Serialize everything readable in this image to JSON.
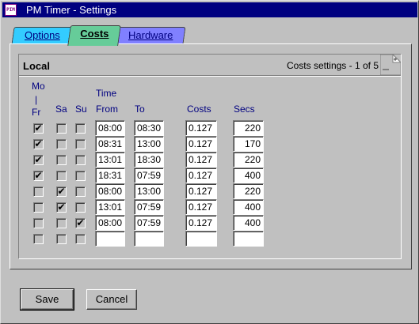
{
  "window": {
    "title": "PM Timer - Settings",
    "icon_name": "pm-app-icon",
    "icon_text": "PIM"
  },
  "tabs": [
    {
      "label": "Options",
      "accent": "#33ccff"
    },
    {
      "label": "Costs",
      "accent": "#66cc99",
      "active": true
    },
    {
      "label": "Hardware",
      "accent": "#8080ff"
    }
  ],
  "section": {
    "title": "Local",
    "page_info": "Costs settings - 1 of 5",
    "next_page_icon": "page-curl-icon"
  },
  "columns": {
    "mo_fr": [
      "Mo",
      "|",
      "Fr"
    ],
    "sa": "Sa",
    "su": "Su",
    "time": "Time",
    "from": "From",
    "to": "To",
    "costs": "Costs",
    "secs": "Secs"
  },
  "rows": [
    {
      "mo_fr": true,
      "sa": false,
      "su": false,
      "from": "08:00",
      "to": "08:30",
      "costs": "0.127",
      "secs": "220"
    },
    {
      "mo_fr": true,
      "sa": false,
      "su": false,
      "from": "08:31",
      "to": "13:00",
      "costs": "0.127",
      "secs": "170"
    },
    {
      "mo_fr": true,
      "sa": false,
      "su": false,
      "from": "13:01",
      "to": "18:30",
      "costs": "0.127",
      "secs": "220"
    },
    {
      "mo_fr": true,
      "sa": false,
      "su": false,
      "from": "18:31",
      "to": "07:59",
      "costs": "0.127",
      "secs": "400"
    },
    {
      "mo_fr": false,
      "sa": true,
      "su": false,
      "from": "08:00",
      "to": "13:00",
      "costs": "0.127",
      "secs": "220"
    },
    {
      "mo_fr": false,
      "sa": true,
      "su": false,
      "from": "13:01",
      "to": "07:59",
      "costs": "0.127",
      "secs": "400"
    },
    {
      "mo_fr": false,
      "sa": false,
      "su": true,
      "from": "08:00",
      "to": "07:59",
      "costs": "0.127",
      "secs": "400"
    },
    {
      "mo_fr": false,
      "sa": false,
      "su": false,
      "from": "",
      "to": "",
      "costs": "",
      "secs": ""
    }
  ],
  "buttons": {
    "save": "Save",
    "cancel": "Cancel"
  },
  "colors": {
    "titlebar": "#000080",
    "header_text": "#000080",
    "face": "#c0c0c0"
  }
}
